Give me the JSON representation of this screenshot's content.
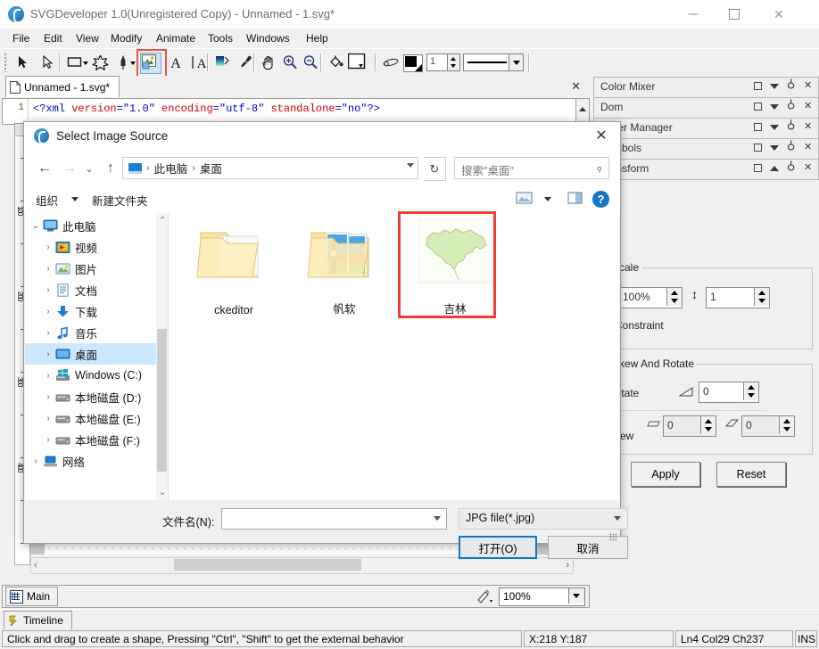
{
  "window": {
    "title": "SVGDeveloper 1.0(Unregistered Copy) - Unnamed - 1.svg*",
    "icon": "app-logo-icon",
    "buttons": {
      "minimize": "—",
      "maximize": "□",
      "close": "✕"
    }
  },
  "menubar": {
    "items": [
      {
        "label": "File",
        "accel": "F"
      },
      {
        "label": "Edit",
        "accel": "E"
      },
      {
        "label": "View",
        "accel": "V"
      },
      {
        "label": "Modify",
        "accel": "M"
      },
      {
        "label": "Animate",
        "accel": "A"
      },
      {
        "label": "Tools",
        "accel": "T"
      },
      {
        "label": "Windows",
        "accel": "W"
      },
      {
        "label": "Help",
        "accel": "H"
      }
    ]
  },
  "toolbar": {
    "tools": [
      {
        "name": "select-arrow-tool"
      },
      {
        "name": "subselect-arrow-tool"
      },
      {
        "name": "rectangle-tool"
      },
      {
        "name": "star-tool"
      },
      {
        "name": "pen-tool"
      },
      {
        "name": "image-tool",
        "active": true,
        "highlighted": true
      },
      {
        "name": "text-tool"
      },
      {
        "name": "vertical-text-tool"
      },
      {
        "name": "gradient-tool"
      },
      {
        "name": "eyedropper-tool"
      },
      {
        "name": "hand-tool"
      },
      {
        "name": "zoom-in-tool"
      },
      {
        "name": "zoom-out-tool"
      },
      {
        "name": "paint-bucket-tool"
      },
      {
        "name": "fill-color-tool"
      },
      {
        "name": "pencil-tool"
      }
    ],
    "stroke_color": "#000000",
    "stroke_width": "1",
    "line_style": "solid"
  },
  "document_tab": {
    "label": "Unnamed - 1.svg*",
    "icon": "document-icon",
    "close": "✕"
  },
  "xml_editor": {
    "line_number": "1",
    "segments": [
      {
        "text": "<?xml ",
        "color": "blue"
      },
      {
        "text": "version",
        "color": "red"
      },
      {
        "text": "=",
        "color": "blue"
      },
      {
        "text": "\"1.0\"",
        "color": "blue"
      },
      {
        "text": " encoding",
        "color": "red"
      },
      {
        "text": "=",
        "color": "blue"
      },
      {
        "text": "\"utf-8\"",
        "color": "blue"
      },
      {
        "text": " standalone",
        "color": "red"
      },
      {
        "text": "=",
        "color": "blue"
      },
      {
        "text": "\"no\"?>",
        "color": "blue"
      }
    ],
    "full_line": "<?xml version=\"1.0\" encoding=\"utf-8\" standalone=\"no\"?>"
  },
  "ruler": {
    "vertical_labels": [
      "100",
      "200",
      "300",
      "400"
    ]
  },
  "right_panels": {
    "headers": [
      {
        "label": "Color Mixer",
        "collapse": "down"
      },
      {
        "label": "Dom",
        "collapse": "down"
      },
      {
        "label": "Layer Manager",
        "collapse": "down"
      },
      {
        "label": "Symbols",
        "collapse": "down"
      },
      {
        "label": "Transform",
        "collapse": "up"
      }
    ],
    "panel_button_names": [
      "maximize",
      "collapse",
      "pin",
      "close"
    ],
    "transform": {
      "scale_group": "Scale",
      "scale_x": "100%",
      "scale_y": "1",
      "constraint_label": "Constraint",
      "skew_rotate_group": "Skew And Rotate",
      "rotate_label": "Rotate",
      "rotate_value": "0",
      "skew_label": "Skew",
      "skew_x": "0",
      "skew_y": "0",
      "apply_label": "Apply",
      "reset_label": "Reset"
    }
  },
  "bottom": {
    "main_tab": "Main",
    "zoom": "100%",
    "timeline_tab": "Timeline"
  },
  "statusbar": {
    "message": "Click and drag to create a shape, Pressing \"Ctrl\", \"Shift\" to get the external behavior",
    "coordinates": "X:218  Y:187",
    "cursor": "Ln4   Col29   Ch237",
    "insert_mode": "INS"
  },
  "dialog": {
    "title": "Select Image Source",
    "close": "✕",
    "nav": {
      "back": "←",
      "forward": "→",
      "recent": "⌄",
      "up": "↑"
    },
    "breadcrumb": {
      "icon": "this-pc-icon",
      "segments": [
        "此电脑",
        "桌面"
      ],
      "separator": "›"
    },
    "refresh": "↻",
    "search": {
      "placeholder": "搜索\"桌面\"",
      "icon": "search-icon"
    },
    "commands": {
      "organize": "组织",
      "new_folder": "新建文件夹",
      "view_icon": "view-layout-icon",
      "view_caret": "▾",
      "preview_pane": "preview-pane-icon",
      "help": "?"
    },
    "tree": [
      {
        "label": "此电脑",
        "icon": "computer-icon",
        "indent": 0,
        "chevron": "⌄",
        "selected": false
      },
      {
        "label": "视频",
        "icon": "videos-icon",
        "indent": 1,
        "chevron": "›",
        "selected": false
      },
      {
        "label": "图片",
        "icon": "pictures-icon",
        "indent": 1,
        "chevron": "›",
        "selected": false
      },
      {
        "label": "文档",
        "icon": "documents-icon",
        "indent": 1,
        "chevron": "›",
        "selected": false
      },
      {
        "label": "下载",
        "icon": "downloads-icon",
        "indent": 1,
        "chevron": "›",
        "selected": false
      },
      {
        "label": "音乐",
        "icon": "music-icon",
        "indent": 1,
        "chevron": "›",
        "selected": false
      },
      {
        "label": "桌面",
        "icon": "desktop-icon",
        "indent": 1,
        "chevron": "›",
        "selected": true
      },
      {
        "label": "Windows (C:)",
        "icon": "windows-drive-icon",
        "indent": 1,
        "chevron": "›",
        "selected": false
      },
      {
        "label": "本地磁盘 (D:)",
        "icon": "drive-icon",
        "indent": 1,
        "chevron": "›",
        "selected": false
      },
      {
        "label": "本地磁盘 (E:)",
        "icon": "drive-icon",
        "indent": 1,
        "chevron": "›",
        "selected": false
      },
      {
        "label": "本地磁盘 (F:)",
        "icon": "drive-icon",
        "indent": 1,
        "chevron": "›",
        "selected": false
      },
      {
        "label": "网络",
        "icon": "network-icon",
        "indent": 0,
        "chevron": "›",
        "selected": false
      }
    ],
    "files": [
      {
        "name": "ckeditor",
        "type": "folder",
        "selected": false
      },
      {
        "name": "帆软",
        "type": "folder-images",
        "selected": false
      },
      {
        "name": "吉林",
        "type": "image-map",
        "selected": true
      }
    ],
    "footer": {
      "filename_label": "文件名(N):",
      "filename_value": "",
      "filetype_value": "JPG file(*.jpg)",
      "open_button": "打开(O)",
      "cancel_button": "取消"
    },
    "selection_color": "#ee3f37"
  }
}
